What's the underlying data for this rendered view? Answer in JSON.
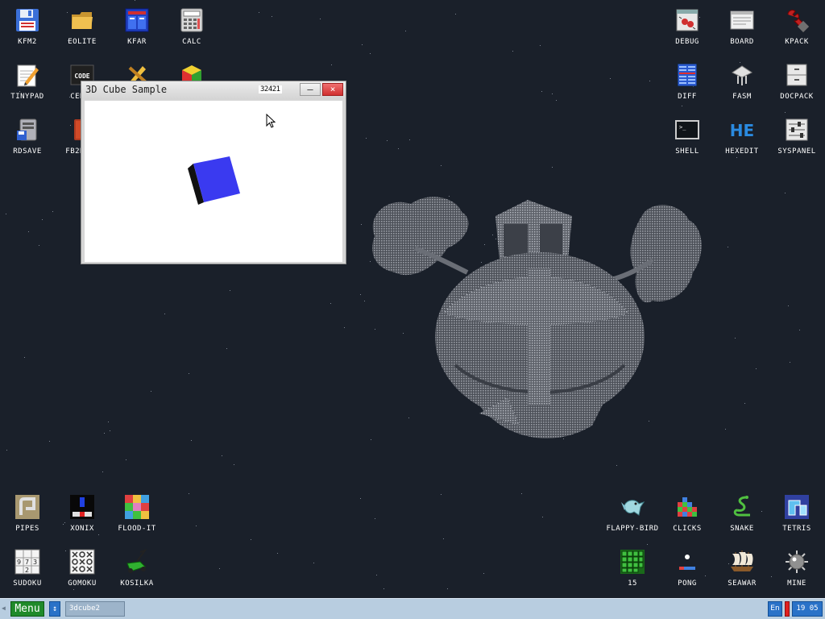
{
  "desktop": {
    "icons_left": [
      {
        "label": "KFM2",
        "icon": "floppy-icon"
      },
      {
        "label": "EOLITE",
        "icon": "folder-icon"
      },
      {
        "label": "KFAR",
        "icon": "kfar-icon"
      },
      {
        "label": "CALC",
        "icon": "calculator-icon"
      },
      {
        "label": "TINYPAD",
        "icon": "notepad-icon"
      },
      {
        "label": "CEDIT",
        "icon": "code-icon"
      },
      {
        "label": "",
        "icon": "pencil-icon"
      },
      {
        "label": "",
        "icon": "rubik-icon"
      },
      {
        "label": "RDSAVE",
        "icon": "rdsave-icon"
      },
      {
        "label": "FB2READ",
        "icon": "book-icon"
      }
    ],
    "icons_right": [
      {
        "label": "DEBUG",
        "icon": "debug-icon"
      },
      {
        "label": "BOARD",
        "icon": "board-icon"
      },
      {
        "label": "KPACK",
        "icon": "wrench-icon"
      },
      {
        "label": "DIFF",
        "icon": "diff-icon"
      },
      {
        "label": "FASM",
        "icon": "fasm-icon"
      },
      {
        "label": "DOCPACK",
        "icon": "docpack-icon"
      },
      {
        "label": "SHELL",
        "icon": "terminal-icon"
      },
      {
        "label": "HEXEDIT",
        "icon": "hexedit-icon"
      },
      {
        "label": "SYSPANEL",
        "icon": "sliders-icon"
      }
    ],
    "games_left": [
      {
        "label": "PIPES",
        "icon": "pipes-icon"
      },
      {
        "label": "XONIX",
        "icon": "xonix-icon"
      },
      {
        "label": "FLOOD-IT",
        "icon": "flood-it-icon"
      },
      {
        "label": "SUDOKU",
        "icon": "sudoku-icon"
      },
      {
        "label": "GOMOKU",
        "icon": "gomoku-icon"
      },
      {
        "label": "KOSILKA",
        "icon": "lawnmower-icon"
      }
    ],
    "games_right": [
      {
        "label": "FLAPPY-BIRD",
        "icon": "bird-icon"
      },
      {
        "label": "CLICKS",
        "icon": "clicks-icon"
      },
      {
        "label": "SNAKE",
        "icon": "snake-icon"
      },
      {
        "label": "TETRIS",
        "icon": "tetris-icon"
      },
      {
        "label": "15",
        "icon": "fifteen-icon"
      },
      {
        "label": "PONG",
        "icon": "pong-icon"
      },
      {
        "label": "SEAWAR",
        "icon": "ship-icon"
      },
      {
        "label": "MINE",
        "icon": "mine-icon"
      }
    ],
    "background_color": "#1a202a"
  },
  "window": {
    "title": "3D Cube Sample",
    "fps": "32421",
    "minimize_label": "–",
    "close_label": "×",
    "cube_color": "#3a3af0"
  },
  "taskbar": {
    "menu_label": "Menu",
    "switch_label": "↕",
    "task_label": "3dcube2",
    "lang_label": "En",
    "clock": "19 05"
  }
}
